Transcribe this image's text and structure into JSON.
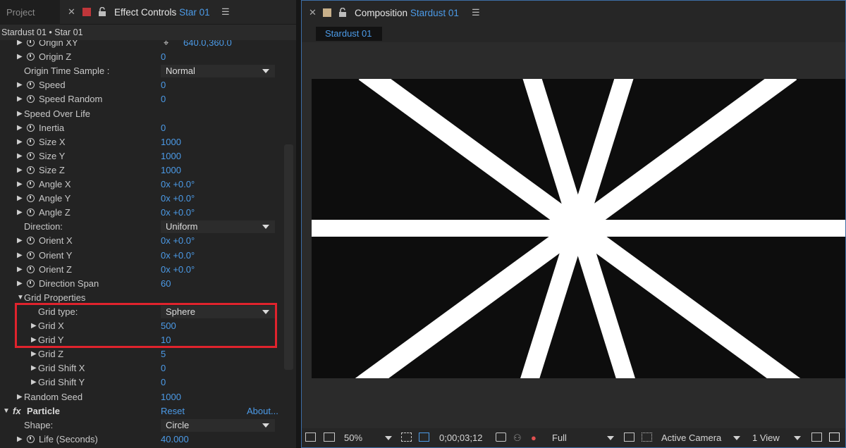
{
  "effect_controls": {
    "project_tab": "Project",
    "title": "Effect Controls",
    "title_accent": "Star 01",
    "breadcrumb": "Stardust 01 • Star 01",
    "rows": [
      {
        "indent": 1,
        "expand": true,
        "stopwatch": true,
        "label": "Origin XY",
        "value": "640.0,360.0",
        "crosshair": true
      },
      {
        "indent": 1,
        "expand": true,
        "stopwatch": true,
        "label": "Origin Z",
        "value": "0"
      },
      {
        "indent": 1,
        "expand": false,
        "stopwatch": false,
        "label": "Origin Time Sample :",
        "dropdown": "Normal"
      },
      {
        "indent": 1,
        "expand": true,
        "stopwatch": true,
        "label": "Speed",
        "value": "0"
      },
      {
        "indent": 1,
        "expand": true,
        "stopwatch": true,
        "label": "Speed Random",
        "value": "0"
      },
      {
        "indent": 1,
        "expand": true,
        "stopwatch": false,
        "label": "Speed Over Life"
      },
      {
        "indent": 1,
        "expand": true,
        "stopwatch": true,
        "label": "Inertia",
        "value": "0"
      },
      {
        "indent": 1,
        "expand": true,
        "stopwatch": true,
        "label": "Size X",
        "value": "1000"
      },
      {
        "indent": 1,
        "expand": true,
        "stopwatch": true,
        "label": "Size Y",
        "value": "1000"
      },
      {
        "indent": 1,
        "expand": true,
        "stopwatch": true,
        "label": "Size Z",
        "value": "1000"
      },
      {
        "indent": 1,
        "expand": true,
        "stopwatch": true,
        "label": "Angle X",
        "value": "0x +0.0°"
      },
      {
        "indent": 1,
        "expand": true,
        "stopwatch": true,
        "label": "Angle Y",
        "value": "0x +0.0°"
      },
      {
        "indent": 1,
        "expand": true,
        "stopwatch": true,
        "label": "Angle Z",
        "value": "0x +0.0°"
      },
      {
        "indent": 1,
        "expand": false,
        "stopwatch": false,
        "label": "Direction:",
        "dropdown": "Uniform"
      },
      {
        "indent": 1,
        "expand": true,
        "stopwatch": true,
        "label": "Orient X",
        "value": "0x +0.0°"
      },
      {
        "indent": 1,
        "expand": true,
        "stopwatch": true,
        "label": "Orient Y",
        "value": "0x +0.0°"
      },
      {
        "indent": 1,
        "expand": true,
        "stopwatch": true,
        "label": "Orient Z",
        "value": "0x +0.0°"
      },
      {
        "indent": 1,
        "expand": true,
        "stopwatch": true,
        "label": "Direction Span",
        "value": "60"
      },
      {
        "indent": 1,
        "expand": true,
        "open": true,
        "stopwatch": false,
        "label": "Grid Properties"
      },
      {
        "indent": 2,
        "expand": false,
        "stopwatch": false,
        "label": "Grid type:",
        "dropdown": "Sphere"
      },
      {
        "indent": 2,
        "expand": true,
        "stopwatch": false,
        "label": "Grid X",
        "value": "500"
      },
      {
        "indent": 2,
        "expand": true,
        "stopwatch": false,
        "label": "Grid Y",
        "value": "10"
      },
      {
        "indent": 2,
        "expand": true,
        "stopwatch": false,
        "label": "Grid Z",
        "value": "5"
      },
      {
        "indent": 2,
        "expand": true,
        "stopwatch": false,
        "label": "Grid Shift X",
        "value": "0"
      },
      {
        "indent": 2,
        "expand": true,
        "stopwatch": false,
        "label": "Grid Shift Y",
        "value": "0"
      },
      {
        "indent": 1,
        "expand": true,
        "stopwatch": false,
        "label": "Random Seed",
        "value": "1000"
      },
      {
        "indent": 0,
        "expand": true,
        "open": true,
        "fx": true,
        "label": "Particle",
        "reset": "Reset",
        "about": "About..."
      },
      {
        "indent": 1,
        "expand": false,
        "stopwatch": false,
        "label": "Shape:",
        "dropdown": "Circle"
      },
      {
        "indent": 1,
        "expand": true,
        "stopwatch": true,
        "label": "Life (Seconds)",
        "value": "40.000"
      }
    ]
  },
  "composition": {
    "title": "Composition",
    "title_accent": "Stardust 01",
    "subtab": "Stardust 01",
    "bottom": {
      "zoom": "50%",
      "timecode": "0;00;03;12",
      "resolution": "Full",
      "camera": "Active Camera",
      "views": "1 View"
    }
  },
  "colors": {
    "accent": "#4c9be8",
    "highlight": "#e0232d",
    "project_swatch": "#c0363a",
    "comp_swatch": "#c8b08a"
  }
}
